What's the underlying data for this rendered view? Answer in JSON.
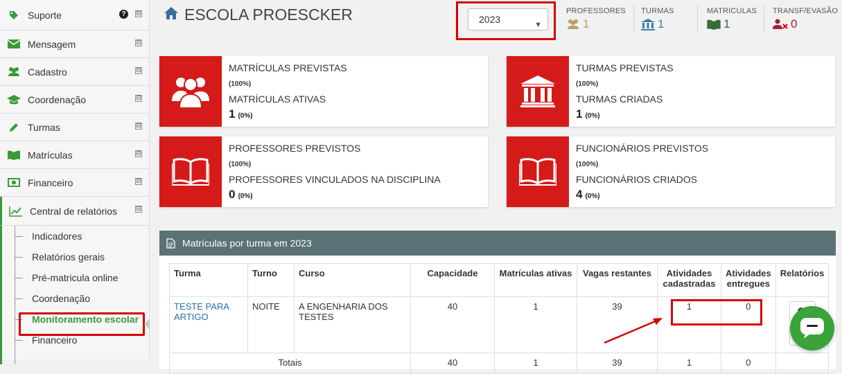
{
  "sidebar": {
    "items": [
      {
        "label": "Suporte"
      },
      {
        "label": "Mensagem"
      },
      {
        "label": "Cadastro"
      },
      {
        "label": "Coordenação"
      },
      {
        "label": "Turmas"
      },
      {
        "label": "Matrículas"
      },
      {
        "label": "Financeiro"
      },
      {
        "label": "Central de relatórios"
      }
    ],
    "subitems": [
      "Indicadores",
      "Relatórios gerais",
      "Pré-matricula online",
      "Coordenação",
      "Monitoramento escolar",
      "Financeiro"
    ],
    "help_glyph": "?",
    "toggle_glyph": "⊟"
  },
  "header": {
    "school_name": "ESCOLA PROESCKER",
    "year": "2023",
    "stats": [
      {
        "label": "PROFESSORES",
        "value": "1",
        "color": "#b8a060"
      },
      {
        "label": "TURMAS",
        "value": "1",
        "color": "#3a7fa0"
      },
      {
        "label": "MATRICULAS",
        "value": "1",
        "color": "#3a6a3a"
      },
      {
        "label": "TRANSF/EVASÃO",
        "value": "0",
        "color": "#a0203a"
      }
    ]
  },
  "cards": [
    {
      "title": "MATRÍCULAS PREVISTAS",
      "pct1": "(100%)",
      "subtitle": "MATRÍCULAS ATIVAS",
      "count": "1",
      "pct2": "(0%)",
      "icon": "users-icon"
    },
    {
      "title": "TURMAS PREVISTAS",
      "pct1": "(100%)",
      "subtitle": "TURMAS CRIADAS",
      "count": "1",
      "pct2": "(0%)",
      "icon": "institution-icon"
    },
    {
      "title": "PROFESSORES PREVISTOS",
      "pct1": "(100%)",
      "subtitle": "PROFESSORES VINCULADOS NA DISCIPLINA",
      "count": "0",
      "pct2": "(0%)",
      "icon": "book-icon"
    },
    {
      "title": "FUNCIONÁRIOS PREVISTOS",
      "pct1": "(100%)",
      "subtitle": "FUNCIONÁRIOS CRIADOS",
      "count": "4",
      "pct2": "(0%)",
      "icon": "book-icon"
    }
  ],
  "panel": {
    "title": "Matrículas por turma em 2023",
    "columns": [
      "Turma",
      "Turno",
      "Curso",
      "Capacidade",
      "Matrículas ativas",
      "Vagas restantes",
      "Atividades cadastradas",
      "Atividades entregues",
      "Relatórios"
    ],
    "rows": [
      {
        "turma": "TESTE PARA ARTIGO",
        "turno": "NOITE",
        "curso": "A ENGENHARIA DOS TESTES",
        "capacidade": "40",
        "matriculas": "1",
        "vagas": "39",
        "cadastradas": "1",
        "entregues": "0"
      }
    ],
    "totals": {
      "label": "Totais",
      "capacidade": "40",
      "matriculas": "1",
      "vagas": "39",
      "cadastradas": "1",
      "entregues": "0"
    }
  },
  "colors": {
    "accent_red": "#d51a1a",
    "sidebar_active": "#3a9a3a",
    "panel_header": "#5a7176",
    "chat": "#3aa33a"
  }
}
